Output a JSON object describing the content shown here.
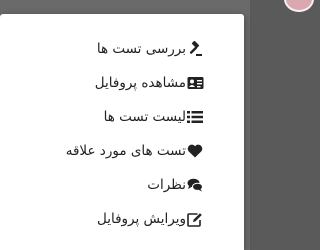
{
  "menu": {
    "items": [
      {
        "label": "بررسی تست ها",
        "icon": "gavel-icon"
      },
      {
        "label": "مشاهده پروفایل",
        "icon": "id-card-icon"
      },
      {
        "label": "لیست تست ها",
        "icon": "list-icon"
      },
      {
        "label": "تست های مورد علاقه",
        "icon": "heart-icon"
      },
      {
        "label": "نظرات",
        "icon": "comments-icon"
      },
      {
        "label": "ویرایش پروفایل",
        "icon": "edit-icon"
      }
    ]
  },
  "colors": {
    "text": "#222222",
    "icon": "#222222",
    "menu_background": "#ffffff",
    "backdrop": "#6a6a6a"
  }
}
